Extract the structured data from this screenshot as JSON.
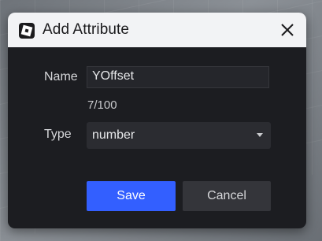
{
  "dialog": {
    "title": "Add Attribute",
    "app_icon": "studio-logo-icon",
    "close_icon": "close-icon"
  },
  "form": {
    "name_label": "Name",
    "name_value": "YOffset",
    "char_counter": "7/100",
    "type_label": "Type",
    "type_value": "number",
    "type_caret_icon": "chevron-down-icon"
  },
  "buttons": {
    "save_label": "Save",
    "cancel_label": "Cancel"
  },
  "colors": {
    "accent": "#335fff",
    "dialog_bg": "#1c1d21",
    "titlebar_bg": "#f2f3f5"
  }
}
